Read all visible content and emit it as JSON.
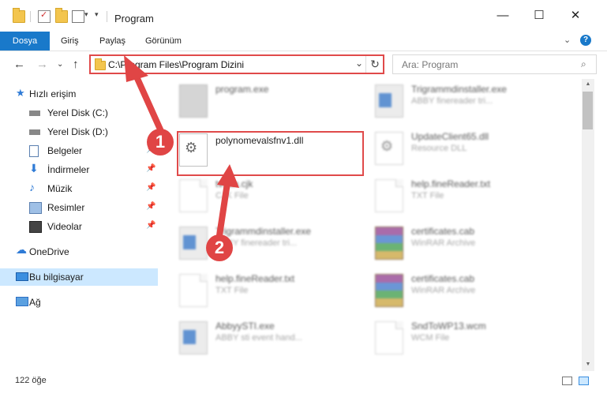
{
  "window": {
    "title": "Program",
    "minimize": "—",
    "maximize": "☐",
    "close": "✕"
  },
  "ribbon": {
    "tabs": [
      "Dosya",
      "Giriş",
      "Paylaş",
      "Görünüm"
    ],
    "expand": "⌄",
    "help": "?"
  },
  "nav": {
    "back": "←",
    "forward": "→",
    "recent": "⌄",
    "up": "↑",
    "address": "C:\\Program Files\\Program Dizini",
    "address_dropdown": "⌄",
    "refresh": "↻",
    "search_placeholder": "Ara: Program"
  },
  "sidebar": {
    "quick_access": "Hızlı erişim",
    "items": [
      {
        "label": "Yerel Disk (C:)",
        "icon": "drive-icon"
      },
      {
        "label": "Yerel Disk (D:)",
        "icon": "drive-icon"
      },
      {
        "label": "Belgeler",
        "icon": "documents-icon"
      },
      {
        "label": "İndirmeler",
        "icon": "downloads-icon"
      },
      {
        "label": "Müzik",
        "icon": "music-icon"
      },
      {
        "label": "Resimler",
        "icon": "pictures-icon"
      },
      {
        "label": "Videolar",
        "icon": "videos-icon"
      }
    ],
    "onedrive": "OneDrive",
    "this_pc": "Bu bilgisayar",
    "network": "Ağ"
  },
  "files": [
    {
      "name": "program.exe",
      "type": "",
      "icon": "package-icon"
    },
    {
      "name": "Trigrammdinstaller.exe",
      "type": "ABBY finereader tri...",
      "icon": "app-icon"
    },
    {
      "name": "polynomevalsfnv1.dll",
      "type": "",
      "icon": "dll-gear-icon"
    },
    {
      "name": "UpdateClient65.dll",
      "type": "Resource DLL",
      "icon": "dll-gear-icon"
    },
    {
      "name": "tvlran.cjk",
      "type": "CJK File",
      "icon": "document-icon"
    },
    {
      "name": "help.fineReader.txt",
      "type": "TXT File",
      "icon": "document-icon"
    },
    {
      "name": "Trigrammdinstaller.exe",
      "type": "ABBY finereader tri...",
      "icon": "app-icon"
    },
    {
      "name": "certificates.cab",
      "type": "WinRAR Archive",
      "icon": "archive-icon"
    },
    {
      "name": "help.fineReader.txt",
      "type": "TXT File",
      "icon": "document-icon"
    },
    {
      "name": "certificates.cab",
      "type": "WinRAR Archive",
      "icon": "archive-icon"
    },
    {
      "name": "AbbyySTI.exe",
      "type": "ABBY sti event hand...",
      "icon": "app-icon"
    },
    {
      "name": "SndToWP13.wcm",
      "type": "WCM File",
      "icon": "document-icon"
    }
  ],
  "status": {
    "count": "122 öğe"
  },
  "callouts": [
    "1",
    "2"
  ],
  "colors": {
    "accent": "#1979ca",
    "highlight": "#e04a4a",
    "selected_nav": "#cce8ff"
  }
}
